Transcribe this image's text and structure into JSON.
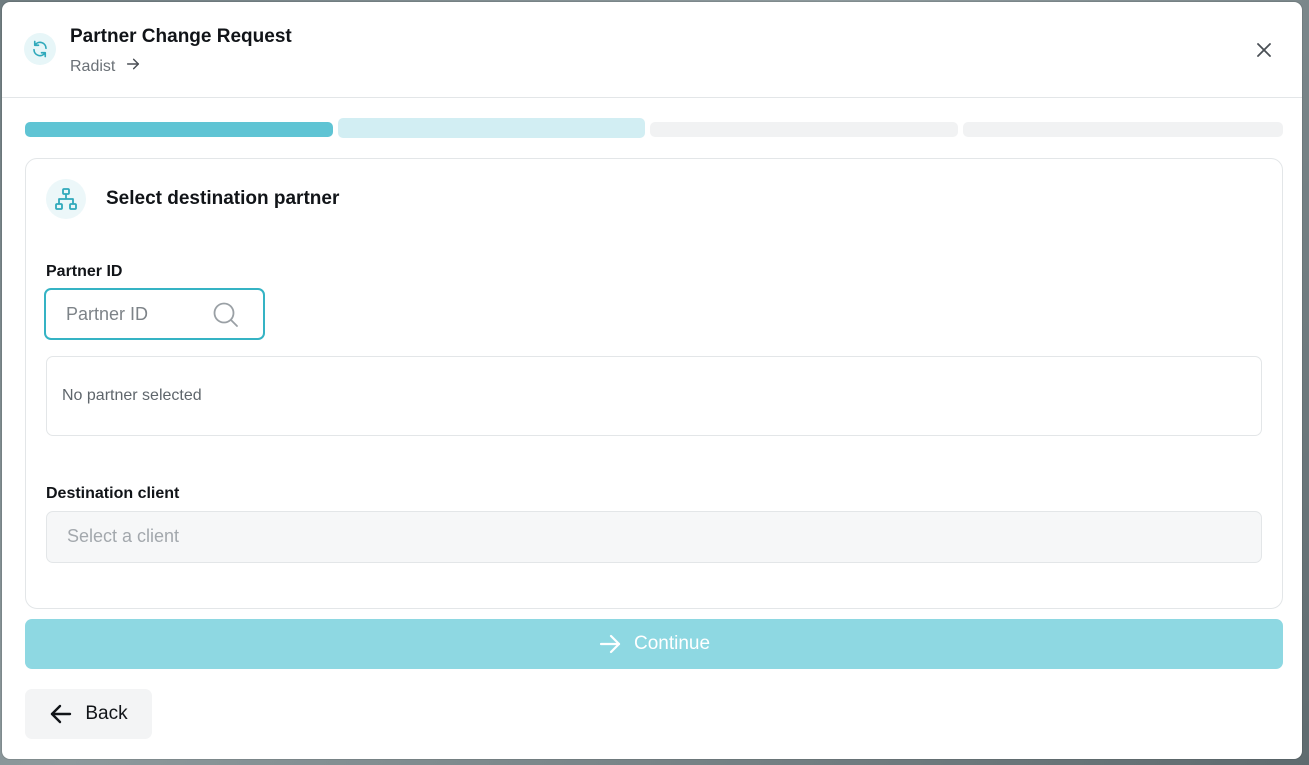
{
  "header": {
    "title": "Partner Change Request",
    "subtitle": "Radist",
    "icon": "refresh-icon",
    "close_icon": "close-icon"
  },
  "progress": {
    "total_steps": 4,
    "current_step": 2,
    "colors": {
      "completed": "#5fc4d4",
      "current": "#d2eef3",
      "pending": "#f1f2f3"
    }
  },
  "card": {
    "icon": "sitemap-icon",
    "title": "Select destination partner",
    "partner_id_label": "Partner ID",
    "partner_id_placeholder": "Partner ID",
    "partner_id_value": "",
    "empty_state": "No partner selected",
    "destination_label": "Destination client",
    "destination_placeholder": "Select a client"
  },
  "actions": {
    "continue_label": "Continue",
    "back_label": "Back"
  },
  "colors": {
    "accent": "#35b3c4",
    "continue_bg": "#8ed8e2"
  }
}
